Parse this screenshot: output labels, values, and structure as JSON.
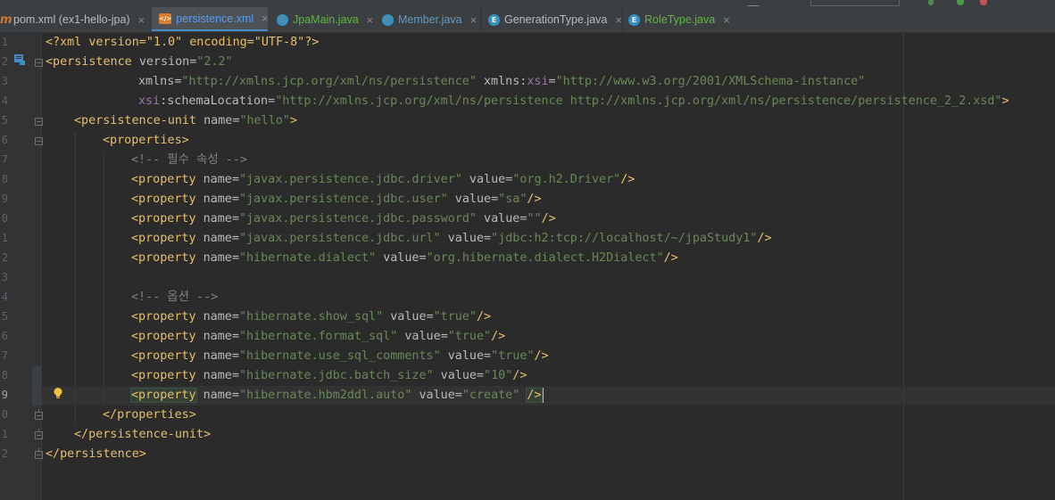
{
  "tabs": [
    {
      "label": "pom.xml (ex1-hello-jpa)",
      "icon": "maven-icon",
      "active": false
    },
    {
      "label": "persistence.xml",
      "icon": "xml-file-icon",
      "active": true
    },
    {
      "label": "JpaMain.java",
      "icon": "class-icon",
      "active": false
    },
    {
      "label": "Member.java",
      "icon": "class-icon",
      "active": false
    },
    {
      "label": "GenerationType.java",
      "icon": "enum-icon",
      "active": false
    },
    {
      "label": "RoleType.java",
      "icon": "enum-icon",
      "active": false
    }
  ],
  "tab_close_glyph": "×",
  "line_numbers": [
    "1",
    "2",
    "3",
    "4",
    "5",
    "6",
    "7",
    "8",
    "9",
    "0",
    "1",
    "2",
    "3",
    "4",
    "5",
    "6",
    "7",
    "8",
    "9",
    "0",
    "1",
    "2"
  ],
  "current_line_index": 18,
  "code": {
    "l1_decl": "<?xml version=\"1.0\" encoding=\"UTF-8\"?>",
    "l2_tag": "<persistence",
    "l2_attr": "version",
    "l2_val": "\"2.2\"",
    "l3_attr1": "xmlns",
    "l3_val1": "\"http://xmlns.jcp.org/xml/ns/persistence\"",
    "l3_attr2a": "xmlns:",
    "l3_attr2b": "xsi",
    "l3_val2": "\"http://www.w3.org/2001/XMLSchema-instance\"",
    "l4_attra": "xsi",
    "l4_attrb": ":schemaLocation",
    "l4_val": "\"http://xmlns.jcp.org/xml/ns/persistence http://xmlns.jcp.org/xml/ns/persistence/persistence_2_2.xsd\"",
    "l4_close": ">",
    "l5_tag": "<persistence-unit",
    "l5_attr": "name",
    "l5_val": "\"hello\"",
    "l5_close": ">",
    "l6_tag": "<properties>",
    "l7_comment": "<!-- 필수 속성 -->",
    "l13_comment": "<!-- 옵션 -->",
    "l20_tag": "</properties>",
    "l21_tag": "</persistence-unit>",
    "l22_tag": "</persistence>",
    "property_tag": "<property",
    "name_attr": "name",
    "value_attr": "value",
    "self_close": "/>",
    "eq": "=",
    "properties": [
      {
        "name": "\"javax.persistence.jdbc.driver\"",
        "value": "\"org.h2.Driver\""
      },
      {
        "name": "\"javax.persistence.jdbc.user\"",
        "value": "\"sa\""
      },
      {
        "name": "\"javax.persistence.jdbc.password\"",
        "value": "\"\""
      },
      {
        "name": "\"javax.persistence.jdbc.url\"",
        "value": "\"jdbc:h2:tcp://localhost/~/jpaStudy1\""
      },
      {
        "name": "\"hibernate.dialect\"",
        "value": "\"org.hibernate.dialect.H2Dialect\""
      },
      {
        "name": "\"hibernate.show_sql\"",
        "value": "\"true\""
      },
      {
        "name": "\"hibernate.format_sql\"",
        "value": "\"true\""
      },
      {
        "name": "\"hibernate.use_sql_comments\"",
        "value": "\"true\""
      },
      {
        "name": "\"hibernate.jdbc.batch_size\"",
        "value": "\"10\""
      },
      {
        "name": "\"hibernate.hbm2ddl.auto\"",
        "value": "\"create\""
      }
    ]
  },
  "colors": {
    "editor_bg": "#2b2b2b",
    "tag": "#e8bf6a",
    "attribute": "#bababa",
    "string": "#6a8759",
    "comment": "#808080",
    "namespace": "#9876aa"
  }
}
